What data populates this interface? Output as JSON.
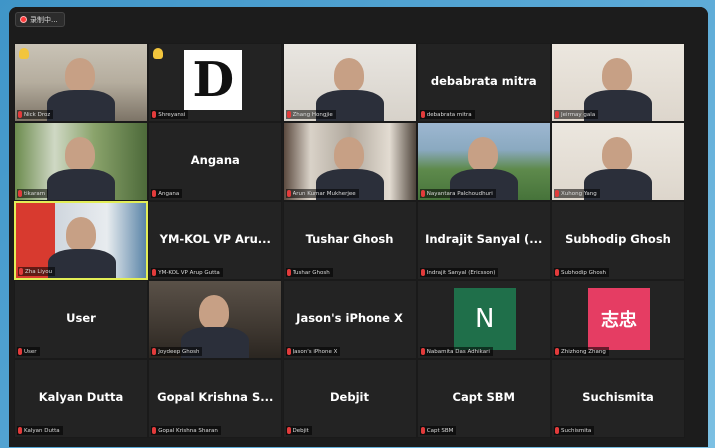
{
  "window": {
    "recording_label": "录制中..."
  },
  "participants": [
    {
      "tag": "Nick Droz",
      "display": "",
      "video": "v-room",
      "hand": true
    },
    {
      "tag": "Shreyansi",
      "display": "",
      "video": "logo",
      "hand": true
    },
    {
      "tag": "Zhang Hongjie",
      "display": "",
      "video": "v-gray",
      "hand": false
    },
    {
      "tag": "debabrata mitra",
      "display": "debabrata mitra",
      "video": "",
      "hand": false
    },
    {
      "tag": "Jeirmay gala",
      "display": "",
      "video": "v-wall",
      "hand": false
    },
    {
      "tag": "tikaram",
      "display": "",
      "video": "v-window",
      "hand": false
    },
    {
      "tag": "Angana",
      "display": "Angana",
      "video": "",
      "hand": false
    },
    {
      "tag": "Arun Kumar Mukherjee",
      "display": "",
      "video": "v-office",
      "hand": false
    },
    {
      "tag": "Nayantara Palchoudhuri",
      "display": "",
      "video": "v-park",
      "hand": false
    },
    {
      "tag": "Xuhong Yang",
      "display": "",
      "video": "v-wall",
      "hand": false
    },
    {
      "tag": "Zha Liyou",
      "display": "",
      "video": "v-flag",
      "hand": false,
      "active": true
    },
    {
      "tag": "YM-KOL VP Arup Gutta",
      "display": "YM-KOL VP Aru...",
      "video": "",
      "hand": false
    },
    {
      "tag": "Tushar Ghosh",
      "display": "Tushar Ghosh",
      "video": "",
      "hand": false
    },
    {
      "tag": "Indrajit Sanyal (Ericsson)",
      "display": "Indrajit Sanyal (...",
      "video": "",
      "hand": false
    },
    {
      "tag": "Subhodip Ghosh",
      "display": "Subhodip Ghosh",
      "video": "",
      "hand": false
    },
    {
      "tag": "User",
      "display": "User",
      "video": "",
      "hand": false
    },
    {
      "tag": "Joydeep Ghosh",
      "display": "",
      "video": "v-cam",
      "hand": false
    },
    {
      "tag": "Jason's iPhone X",
      "display": "Jason's iPhone X",
      "video": "",
      "hand": false
    },
    {
      "tag": "Nabamita Das Adhikari",
      "display": "",
      "video": "n-avatar",
      "avatar": "N",
      "hand": false
    },
    {
      "tag": "Zhizhong Zhang",
      "display": "",
      "video": "zh-avatar",
      "avatar": "志忠",
      "hand": false
    },
    {
      "tag": "Kalyan Dutta",
      "display": "Kalyan Dutta",
      "video": "",
      "hand": false
    },
    {
      "tag": "Gopal Krishna Sharan",
      "display": "Gopal Krishna S...",
      "video": "",
      "hand": false
    },
    {
      "tag": "Debjit",
      "display": "Debjit",
      "video": "",
      "hand": false
    },
    {
      "tag": "Capt SBM",
      "display": "Capt SBM",
      "video": "",
      "hand": false
    },
    {
      "tag": "Suchismita",
      "display": "Suchismita",
      "video": "",
      "hand": false
    }
  ],
  "colors": {
    "background": "#1c1c1c",
    "tile": "#232323",
    "active_border": "#e3ee57",
    "mic_muted": "#e23b3b"
  }
}
